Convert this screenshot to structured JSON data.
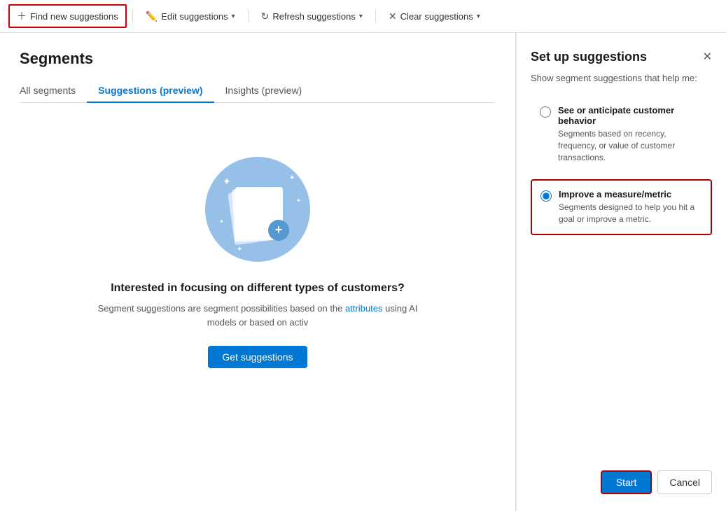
{
  "toolbar": {
    "find_label": "Find new suggestions",
    "edit_label": "Edit suggestions",
    "refresh_label": "Refresh suggestions",
    "clear_label": "Clear suggestions"
  },
  "page": {
    "title": "Segments"
  },
  "tabs": [
    {
      "id": "all",
      "label": "All segments",
      "active": false
    },
    {
      "id": "suggestions",
      "label": "Suggestions (preview)",
      "active": true
    },
    {
      "id": "insights",
      "label": "Insights (preview)",
      "active": false
    }
  ],
  "main": {
    "title": "Interested in focusing on different types of customers?",
    "description": "Segment suggestions are segment possibilities based on the attributes using AI models or based on activ",
    "get_suggestions_label": "Get suggestions"
  },
  "panel": {
    "title": "Set up suggestions",
    "subtitle": "Show segment suggestions that help me:",
    "options": [
      {
        "id": "customer-behavior",
        "label": "See or anticipate customer behavior",
        "description": "Segments based on recency, frequency, or value of customer transactions.",
        "selected": false
      },
      {
        "id": "improve-metric",
        "label": "Improve a measure/metric",
        "description": "Segments designed to help you hit a goal or improve a metric.",
        "selected": true
      }
    ],
    "start_label": "Start",
    "cancel_label": "Cancel"
  }
}
